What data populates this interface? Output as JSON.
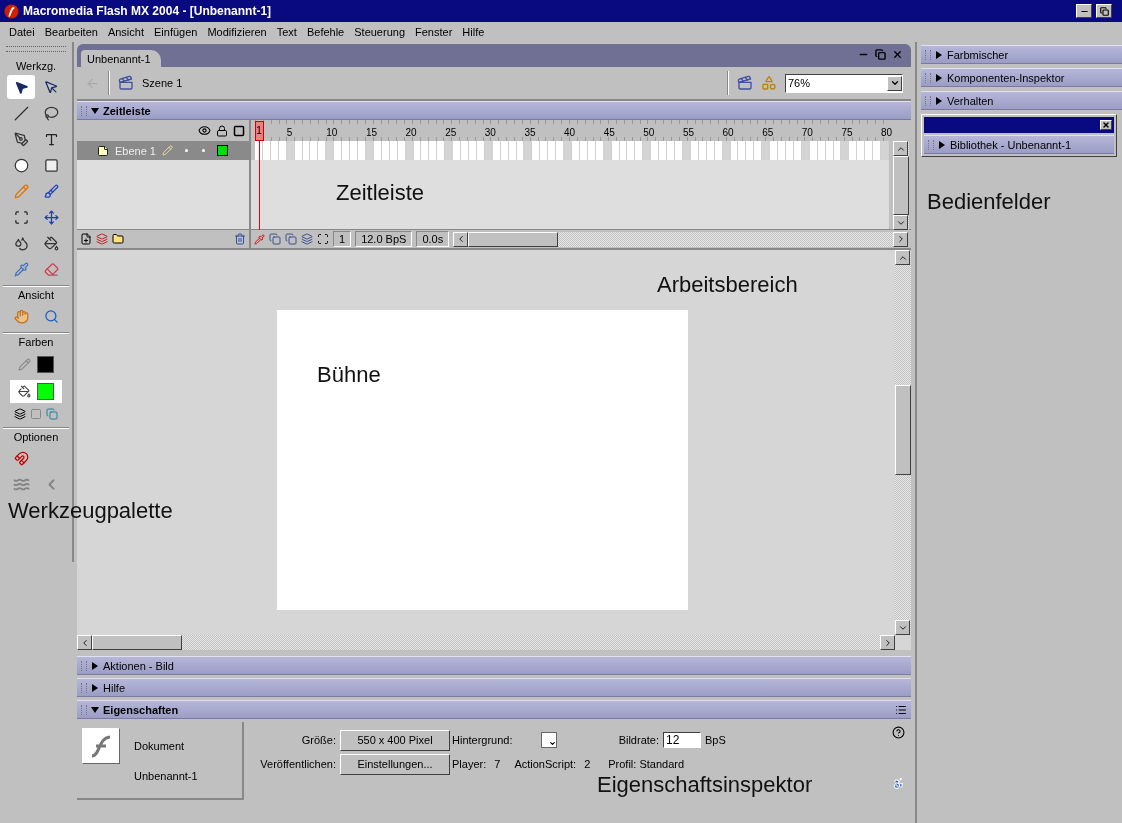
{
  "window": {
    "title": "Macromedia Flash MX 2004 - [Unbenannt-1]"
  },
  "menu": [
    "Datei",
    "Bearbeiten",
    "Ansicht",
    "Einfügen",
    "Modifizieren",
    "Text",
    "Befehle",
    "Steuerung",
    "Fenster",
    "Hilfe"
  ],
  "tools": {
    "title": "Werkzg.",
    "items": [
      {
        "kind": "arrow",
        "selected": true
      },
      {
        "kind": "subselect",
        "selected": false
      },
      {
        "kind": "line",
        "selected": false
      },
      {
        "kind": "lasso",
        "selected": false
      },
      {
        "kind": "pen",
        "selected": false
      },
      {
        "kind": "text",
        "selected": false
      },
      {
        "kind": "oval",
        "selected": false
      },
      {
        "kind": "rectangle",
        "selected": false
      },
      {
        "kind": "pencil",
        "selected": false
      },
      {
        "kind": "brush",
        "selected": false
      },
      {
        "kind": "free-transform",
        "selected": false
      },
      {
        "kind": "fill-transform",
        "selected": false
      },
      {
        "kind": "ink-bottle",
        "selected": false
      },
      {
        "kind": "paint-bucket",
        "selected": false
      },
      {
        "kind": "eyedropper",
        "selected": false
      },
      {
        "kind": "eraser",
        "selected": false
      }
    ],
    "view_title": "Ansicht",
    "view_items": [
      {
        "kind": "hand",
        "selected": false
      },
      {
        "kind": "zoom",
        "selected": false
      }
    ],
    "colors_title": "Farben",
    "colors": [
      {
        "kind": "stroke",
        "color": "#000000",
        "selected": false
      },
      {
        "kind": "fill",
        "color": "#00ff00",
        "selected": true
      }
    ],
    "options_title": "Optionen",
    "options": [
      {
        "kind": "magnet",
        "disabled": false
      },
      {
        "kind": "smooth",
        "disabled": true
      },
      {
        "kind": "straighten",
        "disabled": true
      }
    ],
    "annotation": "Werkzeugpalette"
  },
  "document": {
    "tab": "Unbenannt-1",
    "scene": "Szene 1",
    "zoom": "76%"
  },
  "timeline": {
    "title": "Zeitleiste",
    "expanded": true,
    "frame_numbers": [
      "1",
      "5",
      "10",
      "15",
      "20",
      "25",
      "30",
      "35",
      "40",
      "45",
      "50",
      "55",
      "60",
      "65",
      "70",
      "75",
      "80"
    ],
    "layers": [
      {
        "name": "Ebene 1",
        "selected": true
      }
    ],
    "current_frame": "1",
    "frame_rate": "12.0 BpS",
    "time": "0.0s",
    "annotation": "Zeitleiste"
  },
  "workspace": {
    "annotation": "Arbeitsbereich",
    "stage_annotation": "Bühne"
  },
  "bottom_panels": [
    {
      "title": "Aktionen - Bild",
      "expanded": false
    },
    {
      "title": "Hilfe",
      "expanded": false
    },
    {
      "title": "Eigenschaften",
      "expanded": true
    }
  ],
  "properties": {
    "type": "Dokument",
    "name": "Unbenannt-1",
    "size_label": "Größe:",
    "size": "550 x 400 Pixel",
    "background_label": "Hintergrund:",
    "frame_rate_label": "Bildrate:",
    "frame_rate": "12",
    "frame_rate_unit": "BpS",
    "publish_label": "Veröffentlichen:",
    "publish_button": "Einstellungen...",
    "player_label": "Player:",
    "player": "7",
    "actionscript_label": "ActionScript:",
    "actionscript": "2",
    "profile": "Profil: Standard",
    "annotation": "Eigenschaftsinspektor"
  },
  "right_panels": [
    {
      "title": "Farbmischer",
      "expanded": false
    },
    {
      "title": "Komponenten-Inspektor",
      "expanded": false
    },
    {
      "title": "Verhalten",
      "expanded": false
    }
  ],
  "library": {
    "title": "Bibliothek - Unbenannt-1",
    "expanded": false
  },
  "right_annotation": "Bedienfelder"
}
